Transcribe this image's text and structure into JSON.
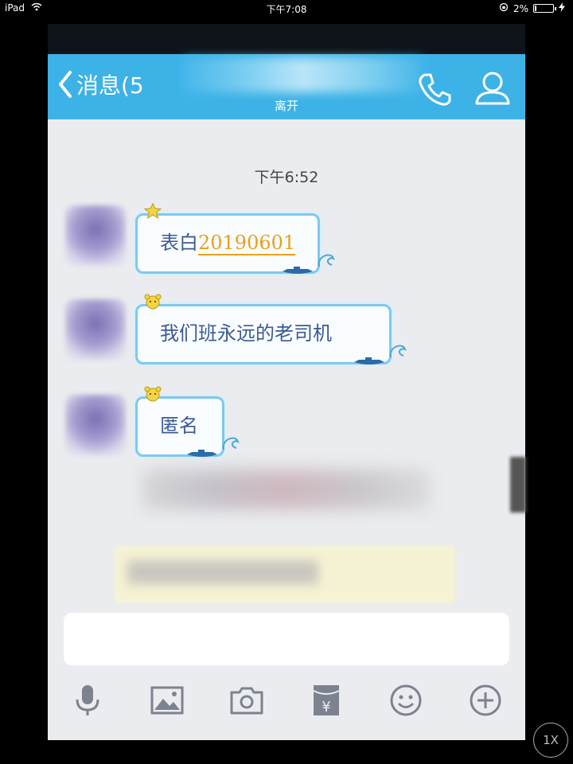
{
  "status_bar": {
    "device": "iPad",
    "time": "下午7:08",
    "battery": "2%"
  },
  "nav": {
    "back_label": "消息(5",
    "status": "离开"
  },
  "chat": {
    "timestamp": "下午6:52",
    "messages": [
      {
        "prefix": "表白",
        "number": "20190601"
      },
      {
        "text": "我们班永远的老司机"
      },
      {
        "text": "匿名"
      }
    ]
  },
  "input": {
    "placeholder": ""
  },
  "toolbar": {
    "icons": [
      "microphone-icon",
      "image-icon",
      "camera-icon",
      "red-packet-icon",
      "emoji-icon",
      "plus-icon"
    ]
  },
  "zoom_label": "1X",
  "colors": {
    "nav_blue": "#3db2e6",
    "bubble_border": "#7fc8ef",
    "text_blue": "#3a5a96",
    "number_orange": "#e8a020"
  }
}
